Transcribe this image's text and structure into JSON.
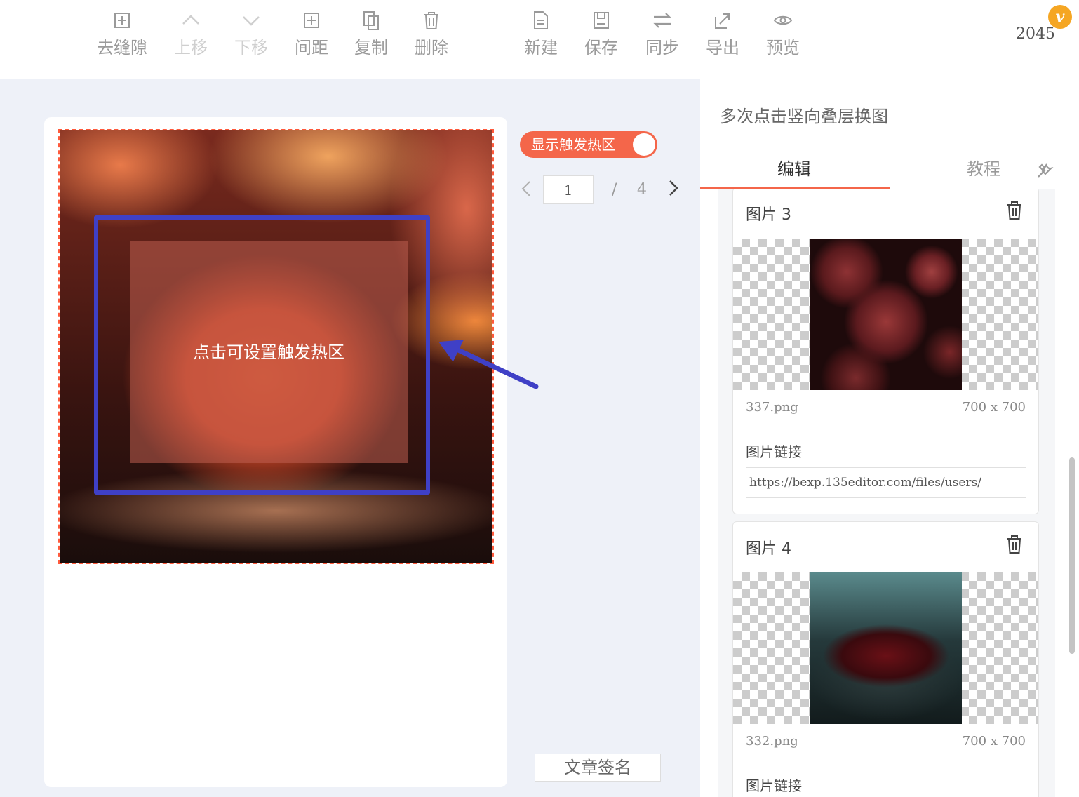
{
  "toolbar": {
    "left_buttons": [
      {
        "label": "去缝隙",
        "icon": "gap-icon",
        "disabled": false
      },
      {
        "label": "上移",
        "icon": "chevron-up-icon",
        "disabled": true
      },
      {
        "label": "下移",
        "icon": "chevron-down-icon",
        "disabled": true
      },
      {
        "label": "间距",
        "icon": "spacing-icon",
        "disabled": false
      },
      {
        "label": "复制",
        "icon": "copy-icon",
        "disabled": false
      },
      {
        "label": "删除",
        "icon": "trash-icon",
        "disabled": false
      }
    ],
    "right_buttons": [
      {
        "label": "新建",
        "icon": "new-file-icon"
      },
      {
        "label": "保存",
        "icon": "save-icon"
      },
      {
        "label": "同步",
        "icon": "sync-icon"
      },
      {
        "label": "导出",
        "icon": "export-icon"
      },
      {
        "label": "预览",
        "icon": "eye-icon"
      }
    ],
    "version_badge": "v",
    "version_number": "2045"
  },
  "canvas": {
    "hotzone_label": "点击可设置触发热区"
  },
  "controls": {
    "toggle_label": "显示触发热区",
    "toggle_on": true,
    "page_current": "1",
    "page_separator": "/",
    "page_total": "4",
    "sign_button": "文章签名"
  },
  "panel": {
    "title": "多次点击竖向叠层换图",
    "tabs": [
      {
        "label": "编辑",
        "active": true
      },
      {
        "label": "教程",
        "active": false
      }
    ],
    "cards": [
      {
        "title": "图片 3",
        "filename": "337.png",
        "size": "700 x 700",
        "link_label": "图片链接",
        "link_value": "https://bexp.135editor.com/files/users/"
      },
      {
        "title": "图片 4",
        "filename": "332.png",
        "size": "700 x 700",
        "link_label": "图片链接"
      }
    ]
  },
  "colors": {
    "accent": "#f4664a",
    "annotation_blue": "#3f40c6",
    "badge": "#f5a623"
  }
}
